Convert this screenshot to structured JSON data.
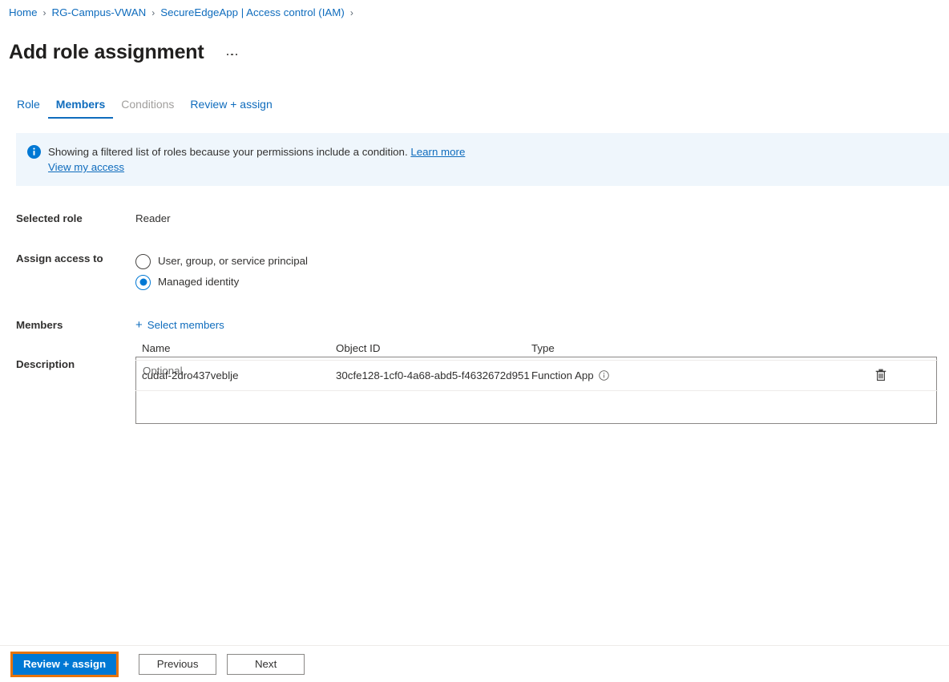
{
  "breadcrumb": {
    "separator": "›",
    "items": [
      {
        "label": "Home"
      },
      {
        "label": "RG-Campus-VWAN"
      },
      {
        "label": "SecureEdgeApp | Access control (IAM)"
      }
    ]
  },
  "header": {
    "title": "Add role assignment",
    "more_menu": "…"
  },
  "tabs": [
    {
      "label": "Role",
      "state": "enabled"
    },
    {
      "label": "Members",
      "state": "selected"
    },
    {
      "label": "Conditions",
      "state": "disabled"
    },
    {
      "label": "Review + assign",
      "state": "enabled"
    }
  ],
  "banner": {
    "icon": "info-icon",
    "message": "Showing a filtered list of roles because your permissions include a condition.",
    "learn_more": "Learn more",
    "view_my_access": "View my access",
    "background_color": "#eff6fc",
    "icon_color": "#0078d4"
  },
  "form": {
    "selected_role": {
      "label": "Selected role",
      "value": "Reader"
    },
    "assign_access_to": {
      "label": "Assign access to",
      "options": [
        {
          "label": "User, group, or service principal",
          "checked": false
        },
        {
          "label": "Managed identity",
          "checked": true
        }
      ]
    },
    "members": {
      "label": "Members",
      "select_members_label": "Select members",
      "select_members_glyph": "+"
    },
    "description": {
      "label": "Description",
      "placeholder": "Optional",
      "value": ""
    }
  },
  "members_table": {
    "columns": [
      "Name",
      "Object ID",
      "Type"
    ],
    "rows": [
      {
        "name": "cudaf-2dro437veblje",
        "object_id": "30cfe128-1cf0-4a68-abd5-f4632672d951",
        "type": "Function App",
        "type_info_icon": "info-circle-icon",
        "delete_icon": "trash-icon"
      }
    ]
  },
  "footer": {
    "review_assign": "Review + assign",
    "previous": "Previous",
    "next": "Next",
    "primary_color": "#0078d4",
    "focus_outline_color": "#e8740c"
  }
}
